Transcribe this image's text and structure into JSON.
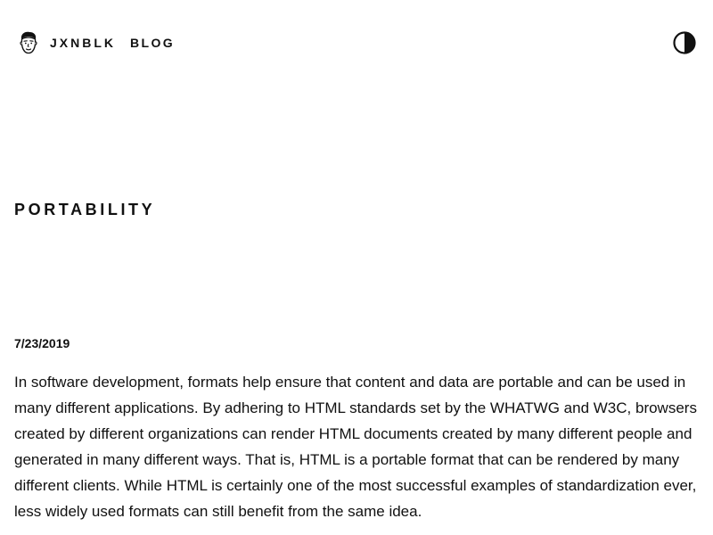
{
  "header": {
    "avatar_icon": "cartoon-face-icon",
    "site_name": "JXNBLK",
    "nav": {
      "blog_label": "BLOG"
    },
    "theme_toggle_icon": "contrast-half-circle-icon"
  },
  "article": {
    "title": "PORTABILITY",
    "date": "7/23/2019",
    "body": "In software development, formats help ensure that content and data are portable and can be used in many different applications. By adhering to HTML standards set by the WHATWG and W3C, browsers created by different organizations can render HTML documents created by many different people and generated in many different ways. That is, HTML is a portable format that can be rendered by many different clients. While HTML is certainly one of the most successful examples of standardization ever, less widely used formats can still benefit from the same idea."
  }
}
